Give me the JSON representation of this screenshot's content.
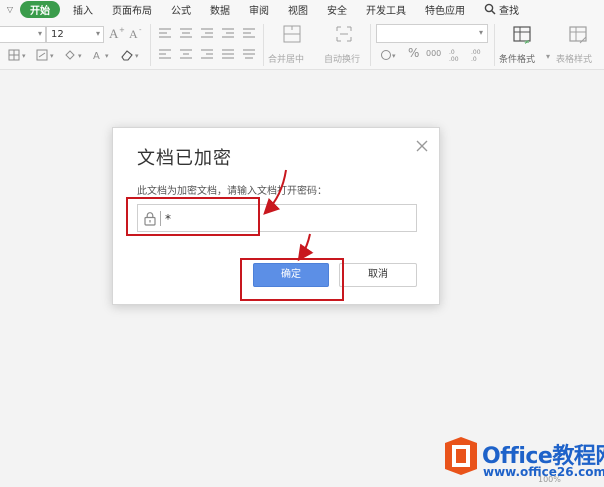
{
  "ribbon": {
    "tabs": [
      "开始",
      "插入",
      "页面布局",
      "公式",
      "数据",
      "审阅",
      "视图",
      "安全",
      "开发工具",
      "特色应用"
    ],
    "active_tab": "开始",
    "search_label": "查找",
    "font_size": "12",
    "merge_label": "合并居中",
    "wrap_label": "自动换行",
    "conditional_format_label": "条件格式",
    "table_style_label": "表格样式",
    "percent_symbol": "%",
    "comma_symbol": "000"
  },
  "dialog": {
    "title": "文档已加密",
    "prompt": "此文档为加密文档，请输入文档打开密码：",
    "password_value": "*",
    "ok_label": "确定",
    "cancel_label": "取消"
  },
  "statusbar": {
    "zoom": "100%"
  },
  "watermark": {
    "name": "Office教程网",
    "url": "www.office26.com"
  },
  "colors": {
    "active_tab": "#3a9c4b",
    "primary_button": "#5c8fe6",
    "annotation": "#c8171e",
    "watermark": "#1e62c9"
  }
}
